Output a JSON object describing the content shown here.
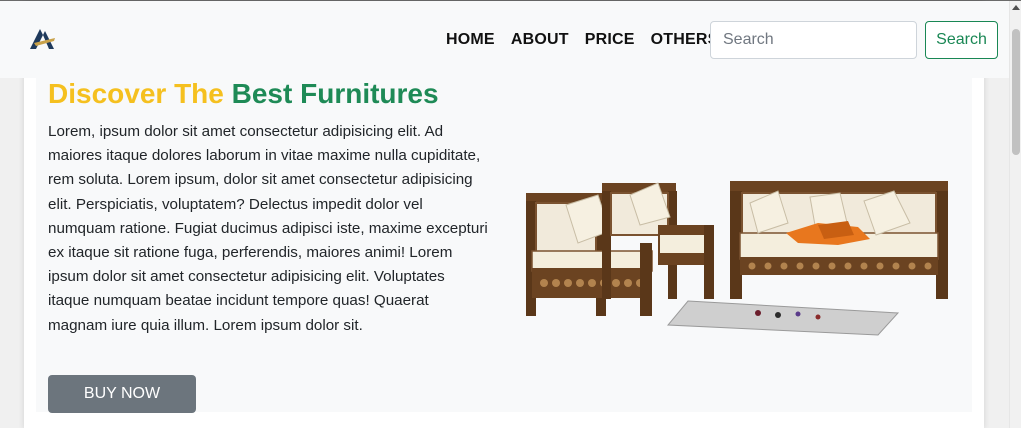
{
  "navbar": {
    "logo_icon": "brand-logo",
    "links": [
      "HOME",
      "ABOUT",
      "PRICE",
      "OTHERS"
    ],
    "search": {
      "placeholder": "Search",
      "value": ""
    },
    "search_button": "Search"
  },
  "hero": {
    "title_part1": "Discover The",
    "title_part2": "Best Furnitures",
    "description": "Lorem, ipsum dolor sit amet consectetur adipisicing elit. Ad maiores itaque dolores laborum in vitae maxime nulla cupiditate, rem soluta. Lorem ipsum, dolor sit amet consectetur adipisicing elit. Perspiciatis, voluptatem? Delectus impedit dolor vel numquam ratione. Fugiat ducimus adipisci iste, maxime excepturi ex itaque sit ratione fuga, perferendis, maiores animi! Lorem ipsum dolor sit amet consectetur adipisicing elit. Voluptates itaque numquam beatae incidunt tempore quas! Quaerat magnam iure quia illum. Lorem ipsum dolor sit.",
    "buy_button": "BUY NOW",
    "image": "wooden-sofa-set-image"
  },
  "colors": {
    "title_yellow": "#f5c01f",
    "title_green": "#1e8a56",
    "search_outline": "#198754",
    "buy_button_bg": "#6c757d"
  }
}
